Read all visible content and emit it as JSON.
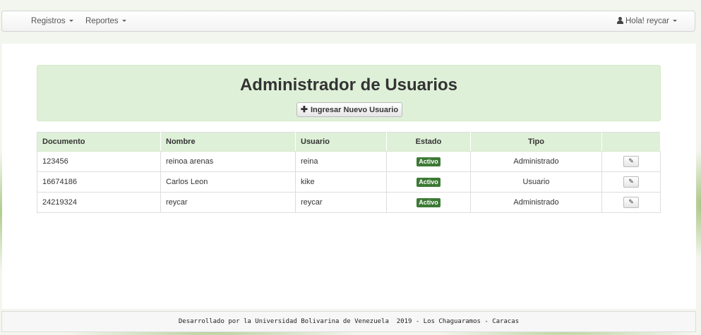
{
  "navbar": {
    "menu_registros": "Registros",
    "menu_reportes": "Reportes",
    "user_greeting": "Hola! reycar"
  },
  "panel": {
    "title": "Administrador de Usuarios",
    "new_user_button": "Ingresar Nuevo Usuario"
  },
  "table": {
    "headers": [
      "Documento",
      "Nombre",
      "Usuario",
      "Estado",
      "Tipo",
      ""
    ],
    "rows": [
      {
        "documento": "123456",
        "nombre": "reinoa arenas",
        "usuario": "reina",
        "estado": "Activo",
        "tipo": "Administrado"
      },
      {
        "documento": "16674186",
        "nombre": "Carlos Leon",
        "usuario": "kike",
        "estado": "Activo",
        "tipo": "Usuario"
      },
      {
        "documento": "24219324",
        "nombre": "reycar",
        "usuario": "reycar",
        "estado": "Activo",
        "tipo": "Administrado"
      }
    ]
  },
  "footer": {
    "text": "Desarrollado por la Universidad Bolivarina de Venezuela  2019 - Los Chaguaramos - Caracas"
  },
  "icons": {
    "user": "user-icon",
    "plus": "plus-icon",
    "edit": "edit-icon",
    "caret": "caret-down-icon"
  },
  "colors": {
    "panel_bg": "#dff0d8",
    "badge_success": "#3c7a34"
  }
}
